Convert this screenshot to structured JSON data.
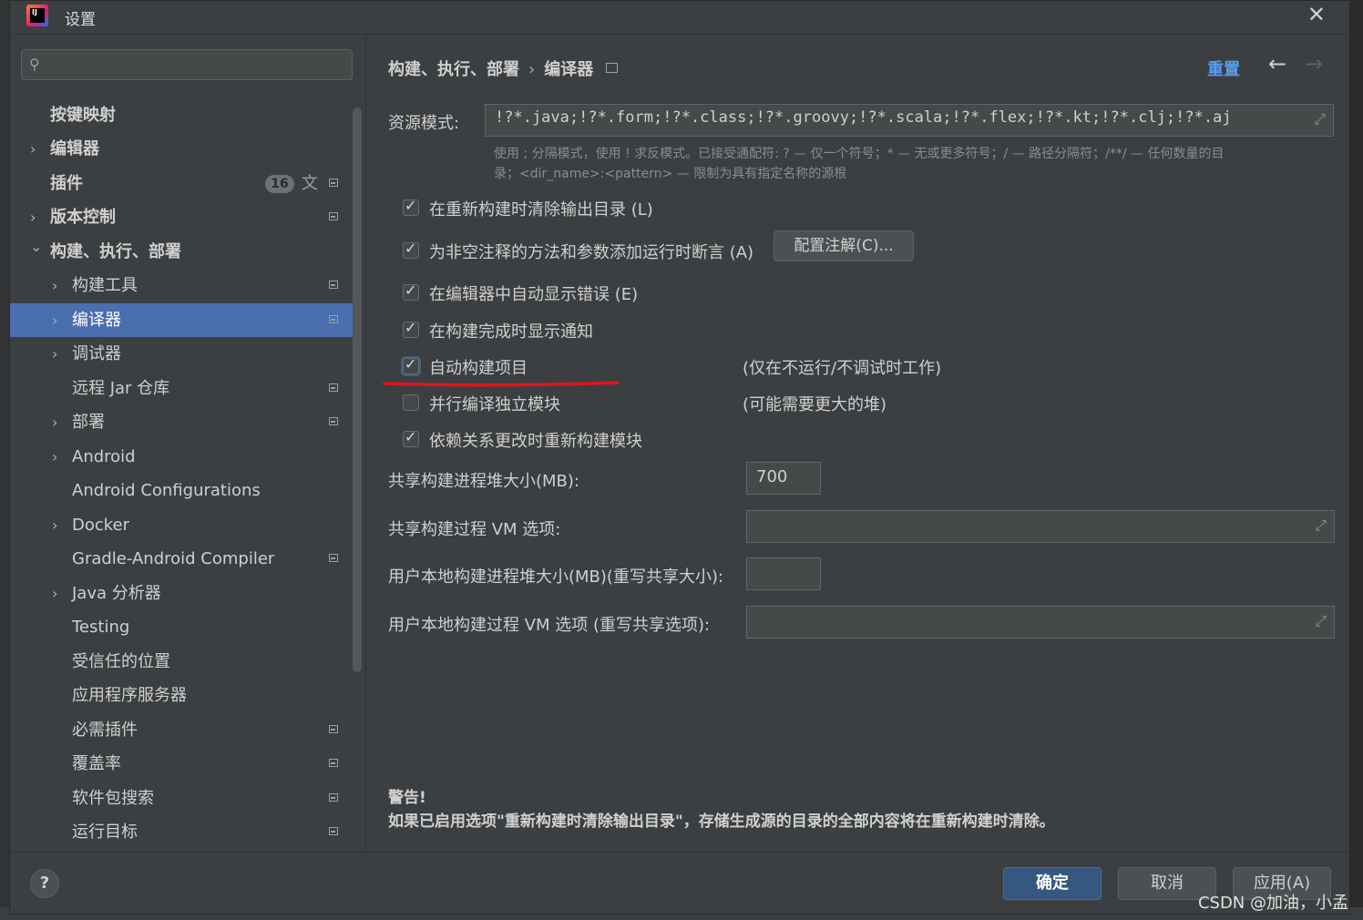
{
  "window": {
    "title": "设置"
  },
  "search": {
    "placeholder": ""
  },
  "tree": [
    {
      "label": "按键映射",
      "bold": true
    },
    {
      "label": "编辑器",
      "bold": true
    },
    {
      "label": "插件",
      "bold": true,
      "badge": "16"
    },
    {
      "label": "版本控制",
      "bold": true
    },
    {
      "label": "构建、执行、部署",
      "bold": true
    },
    {
      "label": "构建工具"
    },
    {
      "label": "编译器",
      "selected": true
    },
    {
      "label": "调试器"
    },
    {
      "label": "远程 Jar 仓库"
    },
    {
      "label": "部署"
    },
    {
      "label": "Android"
    },
    {
      "label": "Android Configurations"
    },
    {
      "label": "Docker"
    },
    {
      "label": "Gradle-Android Compiler"
    },
    {
      "label": "Java 分析器"
    },
    {
      "label": "Testing"
    },
    {
      "label": "受信任的位置"
    },
    {
      "label": "应用程序服务器"
    },
    {
      "label": "必需插件"
    },
    {
      "label": "覆盖率"
    },
    {
      "label": "软件包搜索"
    },
    {
      "label": "运行目标"
    }
  ],
  "breadcrumb": {
    "parent": "构建、执行、部署",
    "current": "编译器",
    "separator": "›"
  },
  "header": {
    "reset": "重置",
    "back": "←",
    "forward": "→"
  },
  "resource": {
    "label": "资源模式:",
    "value": "!?*.java;!?*.form;!?*.class;!?*.groovy;!?*.scala;!?*.flex;!?*.kt;!?*.clj;!?*.aj",
    "hint_line1": "使用 ; 分隔模式，使用 ! 求反模式。已接受通配符: ? — 仅一个符号；* — 无或更多符号；/ — 路径分隔符；/**/ — 任何数量的目",
    "hint_line2": "录；<dir_name>:<pattern> — 限制为具有指定名称的源根"
  },
  "options": [
    {
      "label": "在重新构建时清除输出目录 (L)",
      "checked": true
    },
    {
      "label": "为非空注释的方法和参数添加运行时断言 (A)",
      "checked": true
    },
    {
      "label": "在编辑器中自动显示错误 (E)",
      "checked": true
    },
    {
      "label": "在构建完成时显示通知",
      "checked": true
    },
    {
      "label": "自动构建项目",
      "checked": true,
      "note": "(仅在不运行/不调试时工作)"
    },
    {
      "label": "并行编译独立模块",
      "checked": false,
      "note": "(可能需要更大的堆)"
    },
    {
      "label": "依赖关系更改时重新构建模块",
      "checked": true
    }
  ],
  "configure_annotations": "配置注解(C)...",
  "fields": {
    "heap_label": "共享构建进程堆大小(MB):",
    "heap_value": "700",
    "vm_label": "共享构建过程 VM 选项:",
    "vm_value": "",
    "user_heap_label": "用户本地构建进程堆大小(MB)(重写共享大小):",
    "user_heap_value": "",
    "user_vm_label": "用户本地构建过程 VM 选项 (重写共享选项):",
    "user_vm_value": ""
  },
  "warning": {
    "title": "警告!",
    "text": "如果已启用选项\"重新构建时清除输出目录\"，存储生成源的目录的全部内容将在重新构建时清除。"
  },
  "footer": {
    "help": "?",
    "ok": "确定",
    "cancel": "取消",
    "apply": "应用(A)"
  },
  "watermark": "CSDN @加油，小孟",
  "colors": {
    "accent": "#4b6eaf",
    "link": "#589df6",
    "annotation": "#e0141e",
    "primary_button": "#365880"
  }
}
